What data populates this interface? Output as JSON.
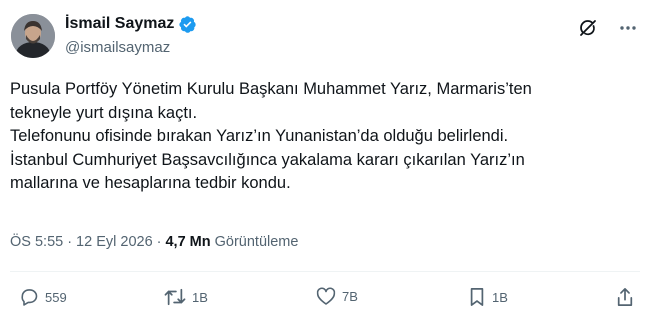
{
  "author": {
    "display_name": "İsmail Saymaz",
    "handle": "@ismailsaymaz",
    "verified": true
  },
  "tweet": {
    "lines": [
      "Pusula Portföy Yönetim Kurulu Başkanı Muhammet Yarız, Marmaris’ten",
      "tekneyle yurt dışına kaçtı.",
      "Telefonunu ofisinde bırakan Yarız’ın Yunanistan’da olduğu belirlendi.",
      "İstanbul Cumhuriyet Başsavcılığınca yakalama kararı çıkarılan Yarız’ın",
      "mallarına ve hesaplarına tedbir kondu."
    ]
  },
  "meta": {
    "time": "ÖS 5:55",
    "separator1": "·",
    "date": "12 Eyl 2026",
    "separator2": "·",
    "views_count": "4,7 Mn",
    "views_label": "Görüntüleme"
  },
  "actions": {
    "reply_count": "559",
    "repost_count": "1B",
    "like_count": "7B",
    "bookmark_count": "1B"
  },
  "icons": {
    "verified": "verified-badge-icon",
    "grok": "grok-icon",
    "more": "more-icon",
    "reply": "reply-icon",
    "repost": "repost-icon",
    "like": "like-icon",
    "bookmark": "bookmark-icon",
    "share": "share-icon"
  },
  "colors": {
    "verified_blue": "#1d9bf0",
    "secondary_text": "#536471",
    "primary_text": "#0f1419"
  }
}
